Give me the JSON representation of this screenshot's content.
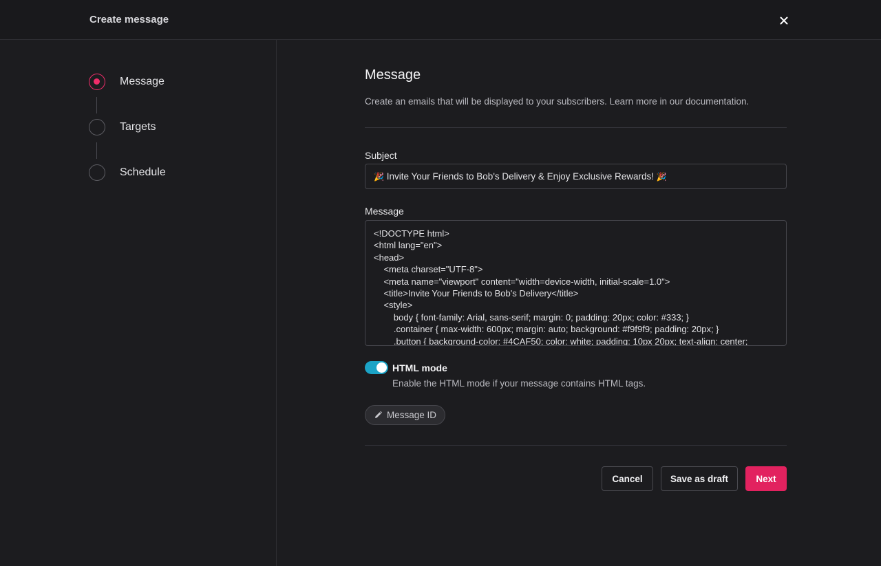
{
  "header": {
    "title": "Create message",
    "close_icon": "close-icon"
  },
  "stepper": {
    "steps": [
      {
        "label": "Message",
        "state": "active"
      },
      {
        "label": "Targets",
        "state": "inactive"
      },
      {
        "label": "Schedule",
        "state": "inactive"
      }
    ]
  },
  "main": {
    "heading": "Message",
    "description": "Create an emails that will be displayed to your subscribers. Learn more in our documentation.",
    "subject": {
      "label": "Subject",
      "value": "Invite Your Friends to Bob's Delivery & Enjoy Exclusive Rewards!",
      "emoji": "🎉"
    },
    "message": {
      "label": "Message",
      "lines": [
        "<!DOCTYPE html>",
        "<html lang=\"en\">",
        "<head>",
        "    <meta charset=\"UTF-8\">",
        "    <meta name=\"viewport\" content=\"width=device-width, initial-scale=1.0\">",
        "    <title>Invite Your Friends to Bob's Delivery</title>",
        "    <style>",
        "        body { font-family: Arial, sans-serif; margin: 0; padding: 20px; color: #333; }",
        "        .container { max-width: 600px; margin: auto; background: #f9f9f9; padding: 20px; }",
        "        .button { background-color: #4CAF50; color: white; padding: 10px 20px; text-align: center;"
      ]
    },
    "html_mode": {
      "title": "HTML mode",
      "description": "Enable the HTML mode if your message contains HTML tags.",
      "enabled": true
    },
    "message_id_button": "Message ID"
  },
  "footer": {
    "cancel": "Cancel",
    "save_draft": "Save as draft",
    "next": "Next"
  },
  "colors": {
    "accent": "#e2225f",
    "toggle_on": "#1ba3c6",
    "background": "#1c1c1f"
  }
}
